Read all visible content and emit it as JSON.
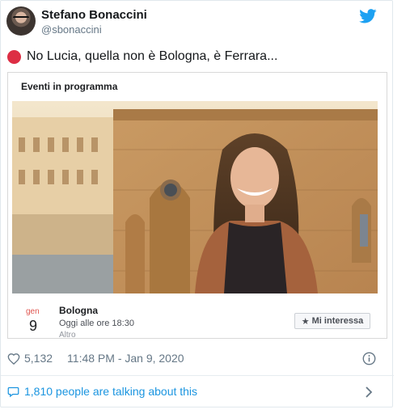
{
  "author": {
    "name": "Stefano Bonaccini",
    "handle": "@sbonaccini"
  },
  "tweet": {
    "emoji_icon": "red-circle-icon",
    "text": "No Lucia, quella non è Bologna, è Ferrara..."
  },
  "embed": {
    "header": "Eventi in programma",
    "event": {
      "month": "gen",
      "day": "9",
      "title": "Bologna",
      "time": "Oggi alle ore 18:30",
      "category": "Altro",
      "button_label": "Mi interessa"
    }
  },
  "footer": {
    "likes": "5,132",
    "timestamp": "11:48 PM - Jan 9, 2020",
    "talking": "1,810 people are talking about this"
  },
  "colors": {
    "twitter_blue": "#1da1f2",
    "link_blue": "#1b95e0",
    "red_dot": "#dd2e44"
  }
}
